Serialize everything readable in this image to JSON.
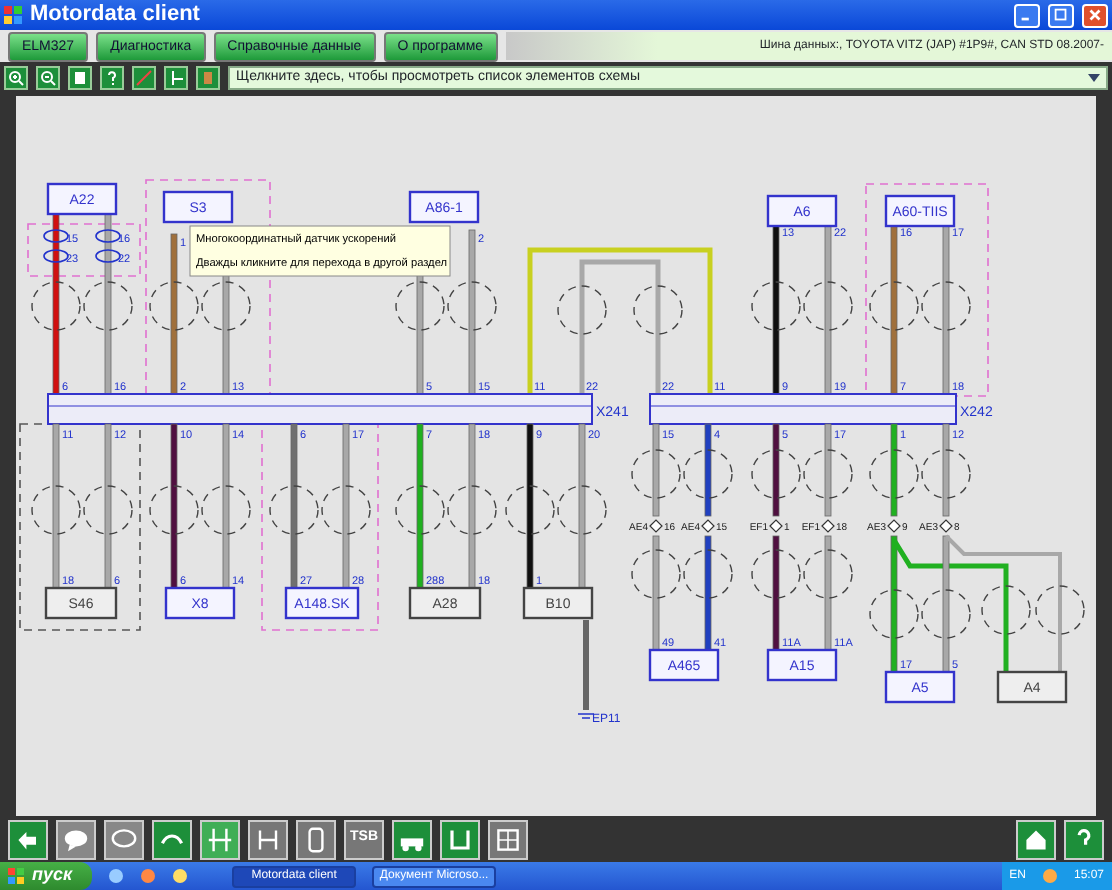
{
  "window": {
    "title": "Motordata client"
  },
  "tabs": [
    {
      "label": "ELM327"
    },
    {
      "label": "Диагностика"
    },
    {
      "label": "Справочные данные"
    },
    {
      "label": "О программе"
    }
  ],
  "status": "Шина данных:, TOYOTA VITZ (JAP) #1P9#,  CAN STD 08.2007-",
  "element_select": {
    "value": "Щелкните здесь, чтобы просмотреть список элементов схемы"
  },
  "diagram": {
    "connectors": [
      {
        "label": "X241"
      },
      {
        "label": "X242"
      }
    ],
    "top_components": [
      {
        "label": "A22",
        "kind": "linked"
      },
      {
        "label": "S3",
        "kind": "linked"
      },
      {
        "label": "A86-1",
        "kind": "linked"
      },
      {
        "label": "A6",
        "kind": "linked"
      },
      {
        "label": "A60-TIIS",
        "kind": "linked"
      }
    ],
    "bottom_components": [
      {
        "label": "S46",
        "kind": "plain"
      },
      {
        "label": "X8",
        "kind": "linked"
      },
      {
        "label": "A148.SK",
        "kind": "linked"
      },
      {
        "label": "A28",
        "kind": "plain"
      },
      {
        "label": "B10",
        "kind": "plain"
      },
      {
        "label": "A465",
        "kind": "linked"
      },
      {
        "label": "A15",
        "kind": "linked"
      },
      {
        "label": "A5",
        "kind": "linked"
      },
      {
        "label": "A4",
        "kind": "plain"
      }
    ],
    "top_wires": [
      {
        "color": "#d01010",
        "pins": [
          "15",
          "23",
          "6"
        ]
      },
      {
        "color": "#a8a8a8",
        "pins": [
          "16",
          "22",
          "16"
        ]
      },
      {
        "color": "#a0703c",
        "pins": [
          "1",
          "2"
        ]
      },
      {
        "color": "#a8a8a8",
        "pins": [
          "13"
        ]
      },
      {
        "color": "#a8a8a8",
        "pins": [
          "5"
        ]
      },
      {
        "color": "#a8a8a8",
        "pins": [
          "2",
          "15"
        ]
      },
      {
        "color": "#c8d020",
        "pins": [
          "11",
          "11"
        ]
      },
      {
        "color": "#a8a8a8",
        "pins": [
          "22",
          "22"
        ]
      },
      {
        "color": "#101010",
        "pins": [
          "13",
          "9"
        ]
      },
      {
        "color": "#a8a8a8",
        "pins": [
          "22",
          "19"
        ]
      },
      {
        "color": "#a0703c",
        "pins": [
          "16",
          "7"
        ]
      },
      {
        "color": "#a8a8a8",
        "pins": [
          "17",
          "18"
        ]
      }
    ],
    "bottom_wires": [
      {
        "color": "#a8a8a8",
        "pins": [
          "11",
          "18"
        ]
      },
      {
        "color": "#a8a8a8",
        "pins": [
          "12",
          "6"
        ]
      },
      {
        "color": "#501040",
        "pins": [
          "10",
          "6"
        ]
      },
      {
        "color": "#a8a8a8",
        "pins": [
          "14",
          "14"
        ]
      },
      {
        "color": "#707070",
        "pins": [
          "6",
          "27"
        ]
      },
      {
        "color": "#a8a8a8",
        "pins": [
          "17",
          "28"
        ]
      },
      {
        "color": "#20b020",
        "pins": [
          "7",
          "288"
        ]
      },
      {
        "color": "#a8a8a8",
        "pins": [
          "18",
          "18"
        ]
      },
      {
        "color": "#101010",
        "pins": [
          "9",
          "1"
        ]
      },
      {
        "color": "#a8a8a8",
        "pins": [
          "20"
        ]
      },
      {
        "color": "#a8a8a8",
        "pins": [
          "15",
          "AE4",
          "16",
          "49"
        ]
      },
      {
        "color": "#2040c0",
        "pins": [
          "4",
          "AE4",
          "15",
          "41"
        ]
      },
      {
        "color": "#501040",
        "pins": [
          "5",
          "EF1",
          "1",
          "11A"
        ]
      },
      {
        "color": "#a8a8a8",
        "pins": [
          "17",
          "EF1",
          "18",
          "11A"
        ]
      },
      {
        "color": "#20b020",
        "pins": [
          "1",
          "AE3",
          "9",
          "17"
        ]
      },
      {
        "color": "#a8a8a8",
        "pins": [
          "12",
          "AE3",
          "8",
          "5"
        ]
      }
    ],
    "ground": {
      "label": "EP11"
    },
    "tooltip": {
      "lines": [
        "Многокоординатный датчик ускорений",
        "Дважды кликните для перехода в другой раздел"
      ]
    }
  },
  "bottom_toolbar": {
    "tsb_label": "TSB"
  },
  "taskbar": {
    "start": "пуск",
    "tasks": [
      {
        "label": "Motordata client",
        "selected": true
      },
      {
        "label": "Документ Microso...",
        "selected": false
      }
    ],
    "language": "EN",
    "time": "15:07"
  }
}
